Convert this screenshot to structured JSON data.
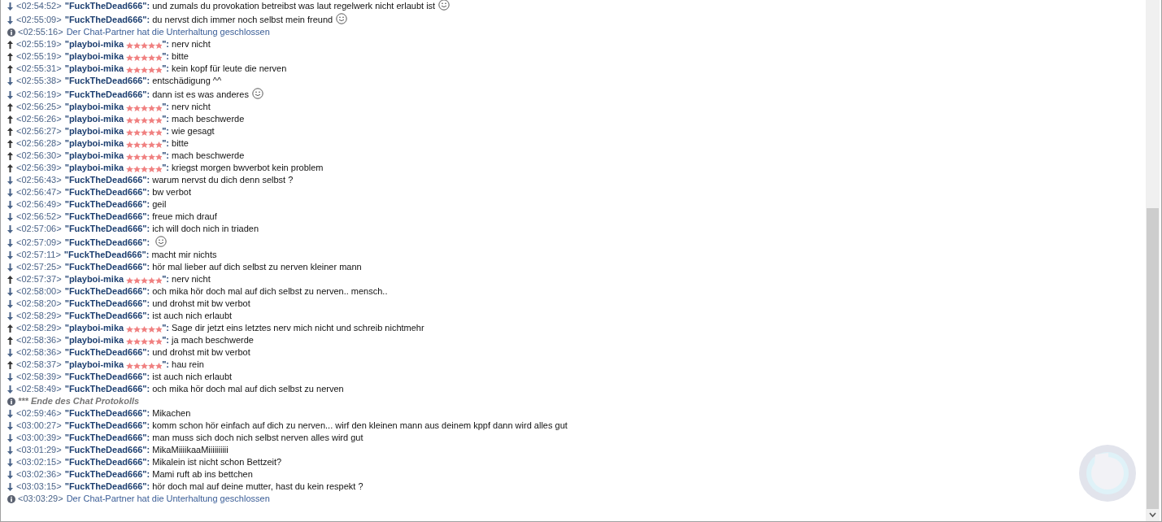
{
  "messages": [
    {
      "kind": "in",
      "time": "<02:54:52>",
      "user": "\"FuckTheDead666\":",
      "text": "und zumals du provokation betreibst was laut regelwerk nicht erlaubt ist",
      "smiley": true
    },
    {
      "kind": "in",
      "time": "<02:55:09>",
      "user": "\"FuckTheDead666\":",
      "text": "du nervst dich immer noch selbst mein freund",
      "smiley": true
    },
    {
      "kind": "system",
      "time": "<02:55:16>",
      "text": "Der Chat-Partner hat die Unterhaltung geschlossen"
    },
    {
      "kind": "out",
      "time": "<02:55:19>",
      "user": "\"playboi-mika",
      "user_end": "\":",
      "text": "nerv nicht"
    },
    {
      "kind": "out",
      "time": "<02:55:19>",
      "user": "\"playboi-mika",
      "user_end": "\":",
      "text": "bitte"
    },
    {
      "kind": "out",
      "time": "<02:55:31>",
      "user": "\"playboi-mika",
      "user_end": "\":",
      "text": "kein kopf für leute die nerven"
    },
    {
      "kind": "in",
      "time": "<02:55:38>",
      "user": "\"FuckTheDead666\":",
      "text": "entschädigung ^^"
    },
    {
      "kind": "in",
      "time": "<02:56:19>",
      "user": "\"FuckTheDead666\":",
      "text": "dann ist es was anderes",
      "smiley": true
    },
    {
      "kind": "out",
      "time": "<02:56:25>",
      "user": "\"playboi-mika",
      "user_end": "\":",
      "text": "nerv nicht"
    },
    {
      "kind": "out",
      "time": "<02:56:26>",
      "user": "\"playboi-mika",
      "user_end": "\":",
      "text": "mach beschwerde"
    },
    {
      "kind": "out",
      "time": "<02:56:27>",
      "user": "\"playboi-mika",
      "user_end": "\":",
      "text": "wie gesagt"
    },
    {
      "kind": "out",
      "time": "<02:56:28>",
      "user": "\"playboi-mika",
      "user_end": "\":",
      "text": "bitte"
    },
    {
      "kind": "out",
      "time": "<02:56:30>",
      "user": "\"playboi-mika",
      "user_end": "\":",
      "text": "mach beschwerde"
    },
    {
      "kind": "out",
      "time": "<02:56:39>",
      "user": "\"playboi-mika",
      "user_end": "\":",
      "text": "kriegst morgen bwverbot  kein problem"
    },
    {
      "kind": "in",
      "time": "<02:56:43>",
      "user": "\"FuckTheDead666\":",
      "text": "warum nervst du dich denn selbst ?"
    },
    {
      "kind": "in",
      "time": "<02:56:47>",
      "user": "\"FuckTheDead666\":",
      "text": "bw verbot"
    },
    {
      "kind": "in",
      "time": "<02:56:49>",
      "user": "\"FuckTheDead666\":",
      "text": "geil"
    },
    {
      "kind": "in",
      "time": "<02:56:52>",
      "user": "\"FuckTheDead666\":",
      "text": "freue mich drauf"
    },
    {
      "kind": "in",
      "time": "<02:57:06>",
      "user": "\"FuckTheDead666\":",
      "text": "ich will doch nich in triaden"
    },
    {
      "kind": "in",
      "time": "<02:57:09>",
      "user": "\"FuckTheDead666\":",
      "smiley": true
    },
    {
      "kind": "in",
      "time": "<02:57:11>",
      "user": "\"FuckTheDead666\":",
      "text": "macht mir nichts"
    },
    {
      "kind": "in",
      "time": "<02:57:25>",
      "user": "\"FuckTheDead666\":",
      "text": "hör mal lieber auf dich selbst zu nerven kleiner mann"
    },
    {
      "kind": "out",
      "time": "<02:57:37>",
      "user": "\"playboi-mika",
      "user_end": "\":",
      "text": "nerv nicht"
    },
    {
      "kind": "in",
      "time": "<02:58:00>",
      "user": "\"FuckTheDead666\":",
      "text": "och mika hör doch mal auf dich selbst zu nerven.. mensch.."
    },
    {
      "kind": "in",
      "time": "<02:58:20>",
      "user": "\"FuckTheDead666\":",
      "text": "und drohst mit bw verbot"
    },
    {
      "kind": "in",
      "time": "<02:58:29>",
      "user": "\"FuckTheDead666\":",
      "text": "ist auch nich erlaubt"
    },
    {
      "kind": "out",
      "time": "<02:58:29>",
      "user": "\"playboi-mika",
      "user_end": "\":",
      "text": "Sage dir jetzt eins letztes nerv mich nicht und schreib nichtmehr"
    },
    {
      "kind": "out",
      "time": "<02:58:36>",
      "user": "\"playboi-mika",
      "user_end": "\":",
      "text": "ja mach beschwerde"
    },
    {
      "kind": "in",
      "time": "<02:58:36>",
      "user": "\"FuckTheDead666\":",
      "text": "und drohst mit bw verbot"
    },
    {
      "kind": "out",
      "time": "<02:58:37>",
      "user": "\"playboi-mika",
      "user_end": "\":",
      "text": "hau rein"
    },
    {
      "kind": "in",
      "time": "<02:58:39>",
      "user": "\"FuckTheDead666\":",
      "text": "ist auch nich erlaubt"
    },
    {
      "kind": "in",
      "time": "<02:58:49>",
      "user": "\"FuckTheDead666\":",
      "text": "och mika hör doch mal auf dich selbst zu nerven"
    },
    {
      "kind": "end",
      "text": "*** Ende des Chat Protokolls"
    },
    {
      "kind": "in",
      "time": "<02:59:46>",
      "user": "\"FuckTheDead666\":",
      "text": "Mikachen"
    },
    {
      "kind": "in",
      "time": "<03:00:27>",
      "user": "\"FuckTheDead666\":",
      "text": "komm schon hör einfach auf dich zu nerven... wirf den kleinen mann aus deinem kppf dann wird alles gut"
    },
    {
      "kind": "in",
      "time": "<03:00:39>",
      "user": "\"FuckTheDead666\":",
      "text": "man muss sich doch nich selbst nerven alles wird gut"
    },
    {
      "kind": "in",
      "time": "<03:01:29>",
      "user": "\"FuckTheDead666\":",
      "text": "MikaMiiiikaaMiiiiiiiiii"
    },
    {
      "kind": "in",
      "time": "<03:02:15>",
      "user": "\"FuckTheDead666\":",
      "text": "Mikalein ist nicht schon Bettzeit?"
    },
    {
      "kind": "in",
      "time": "<03:02:36>",
      "user": "\"FuckTheDead666\":",
      "text": "Mami ruft ab ins bettchen"
    },
    {
      "kind": "in",
      "time": "<03:03:15>",
      "user": "\"FuckTheDead666\":",
      "text": "hör doch mal auf deine mutter, hast du kein respekt ?"
    },
    {
      "kind": "system",
      "time": "<03:03:29>",
      "text": "Der Chat-Partner hat die Unterhaltung geschlossen"
    }
  ]
}
